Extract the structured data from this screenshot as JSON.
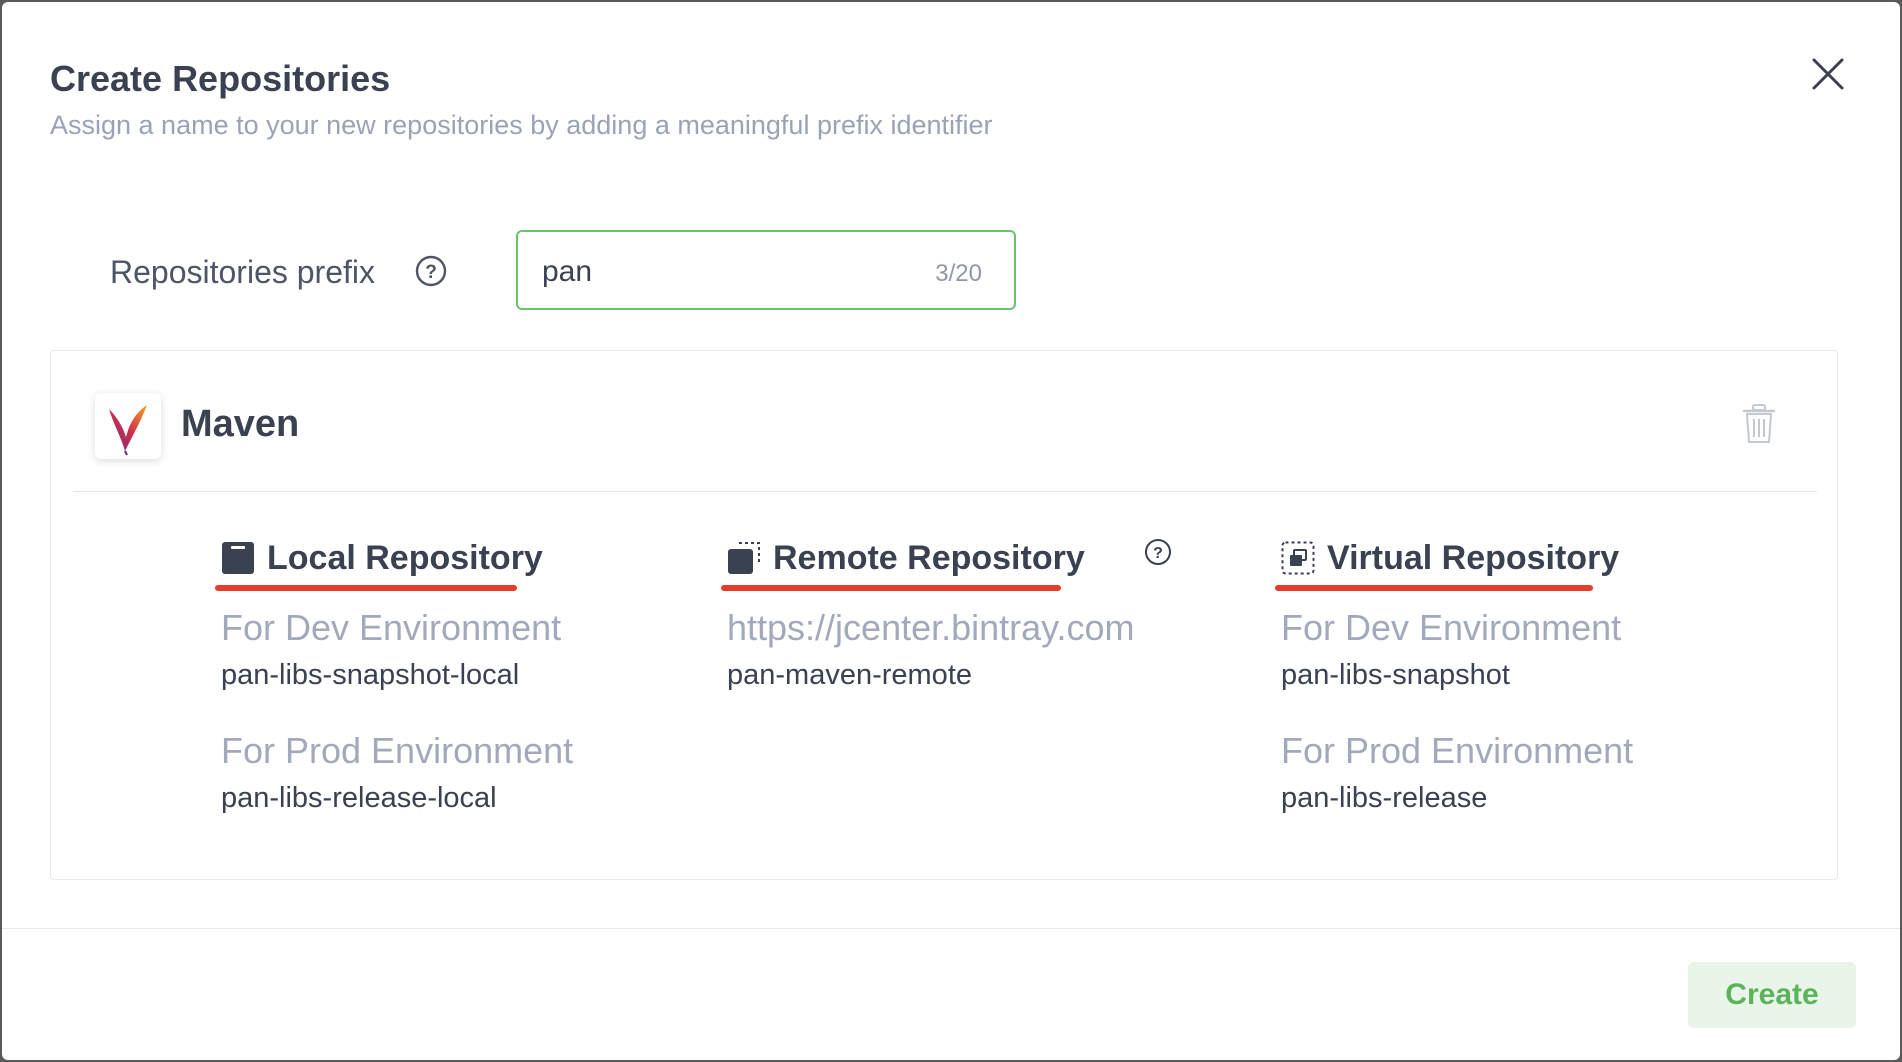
{
  "dialog": {
    "title": "Create Repositories",
    "subtitle": "Assign a name to your new repositories by adding a meaningful prefix identifier",
    "close_icon": "close-icon"
  },
  "prefix": {
    "label": "Repositories prefix",
    "help_icon": "question-circle-icon",
    "value": "pan",
    "counter": "3/20"
  },
  "package": {
    "name": "Maven",
    "logo_icon": "apache-feather-icon",
    "delete_icon": "trash-icon"
  },
  "columns": {
    "local": {
      "title": "Local Repository",
      "icon": "local-repo-icon",
      "dev_label": "For Dev Environment",
      "dev_value": "pan-libs-snapshot-local",
      "prod_label": "For Prod Environment",
      "prod_value": "pan-libs-release-local"
    },
    "remote": {
      "title": "Remote Repository",
      "icon": "remote-repo-icon",
      "help_icon": "question-circle-icon",
      "url": "https://jcenter.bintray.com",
      "value": "pan-maven-remote"
    },
    "virtual": {
      "title": "Virtual Repository",
      "icon": "virtual-repo-icon",
      "dev_label": "For Dev Environment",
      "dev_value": "pan-libs-snapshot",
      "prod_label": "For Prod Environment",
      "prod_value": "pan-libs-release"
    }
  },
  "footer": {
    "create_label": "Create"
  },
  "colors": {
    "accent_green": "#6cc36a",
    "underline_red": "#e43d2c",
    "text_dark": "#3a4150",
    "text_muted": "#a2a9bb"
  }
}
